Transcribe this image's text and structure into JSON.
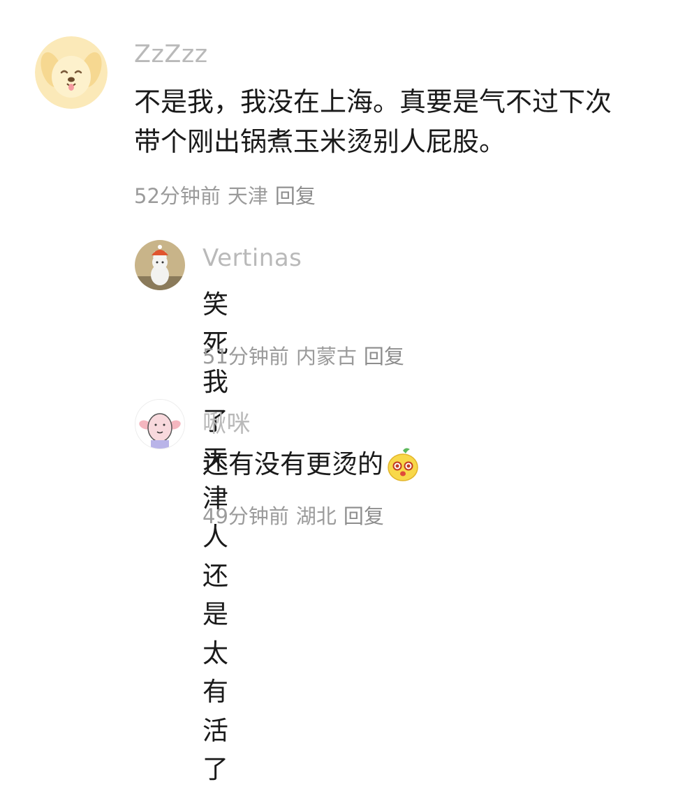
{
  "comments": [
    {
      "username": "ZzZzz",
      "avatar_icon": "dog-avatar-icon",
      "text_lines": [
        "不是我，我没在上海。真要是气不过下次",
        "带个刚出锅煮玉米烫别人屁股。"
      ],
      "time": "52分钟前",
      "location": "天津",
      "reply_label": "回复"
    },
    {
      "username": "Vertinas",
      "avatar_icon": "cat-with-hat-avatar-icon",
      "text": "笑死我了 天津人还是太有活了",
      "time": "51分钟前",
      "location": "内蒙古",
      "reply_label": "回复"
    },
    {
      "username": "啾咪",
      "avatar_icon": "pig-avatar-icon",
      "text": "还有没有更烫的",
      "emoji_icon": "cute-face-emoji-icon",
      "time": "49分钟前",
      "location": "湖北",
      "reply_label": "回复"
    }
  ]
}
